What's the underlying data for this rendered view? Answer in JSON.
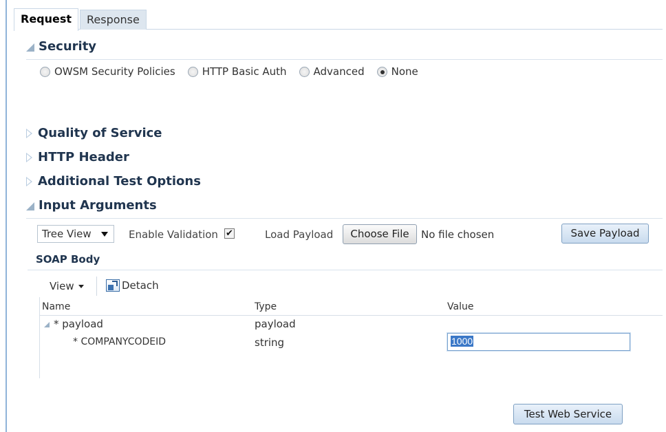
{
  "tabs": [
    {
      "label": "Request",
      "active": true
    },
    {
      "label": "Response",
      "active": false
    }
  ],
  "sections": {
    "security": {
      "label": "Security",
      "expanded": true
    },
    "quality_of_service": {
      "label": "Quality of Service",
      "expanded": false
    },
    "http_header": {
      "label": "HTTP Header",
      "expanded": false
    },
    "additional_test_options": {
      "label": "Additional Test Options",
      "expanded": false
    },
    "input_arguments": {
      "label": "Input Arguments",
      "expanded": true
    }
  },
  "security_options": [
    {
      "label": "OWSM Security Policies",
      "selected": false
    },
    {
      "label": "HTTP Basic Auth",
      "selected": false
    },
    {
      "label": "Advanced",
      "selected": false
    },
    {
      "label": "None",
      "selected": true
    }
  ],
  "input_toolbar": {
    "view_select_value": "Tree View",
    "enable_validation_label": "Enable Validation",
    "enable_validation_checked": true,
    "load_payload_label": "Load Payload",
    "choose_file_label": "Choose File",
    "no_file_text": "No file chosen",
    "save_payload_label": "Save Payload"
  },
  "soap_body": {
    "title": "SOAP Body",
    "view_menu_label": "View",
    "detach_label": "Detach",
    "columns": [
      "Name",
      "Type",
      "Value"
    ],
    "rows": [
      {
        "name": "* payload",
        "type": "payload",
        "value": ""
      },
      {
        "name": "* COMPANYCODEID",
        "type": "string",
        "value": "1000"
      }
    ]
  },
  "test_button_label": "Test Web Service",
  "colors": {
    "section_text": "#20354f",
    "tab_inactive_bg": "#dde6ef",
    "button_blue_bg": "#c9dbee",
    "selection_highlight": "#3b78c7"
  }
}
